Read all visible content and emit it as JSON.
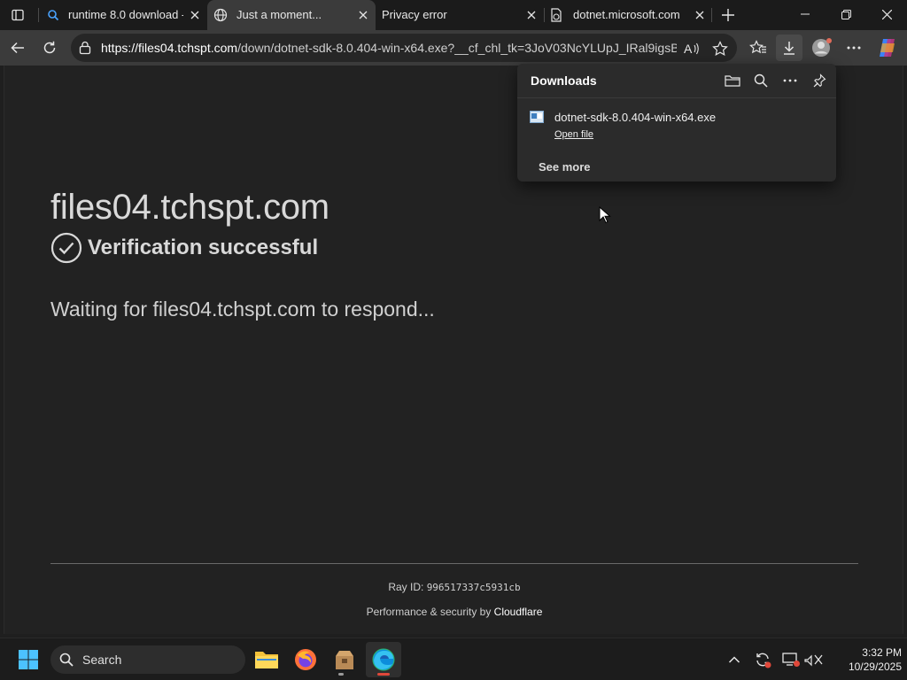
{
  "tabs": [
    {
      "title": "runtime 8.0 download -",
      "icon": "search-icon",
      "active": false
    },
    {
      "title": "Just a moment...",
      "icon": "globe-icon",
      "active": true
    },
    {
      "title": "Privacy error",
      "icon": "none",
      "active": false
    },
    {
      "title": "dotnet.microsoft.com",
      "icon": "warning-page-icon",
      "active": false
    }
  ],
  "address": {
    "host": "https://files04.tchspt.com",
    "rest": "/down/dotnet-sdk-8.0.404-win-x64.exe?__cf_chl_tk=3JoV03NcYLUpJ_IRal9igsB..."
  },
  "page": {
    "host_heading": "files04.tchspt.com",
    "verification": "Verification successful",
    "waiting": "Waiting for files04.tchspt.com to respond...",
    "ray_label": "Ray ID:",
    "ray_id": "996517337c5931cb",
    "perf_label": "Performance & security by",
    "perf_brand": "Cloudflare"
  },
  "downloads": {
    "title": "Downloads",
    "file_name": "dotnet-sdk-8.0.404-win-x64.exe",
    "open_file": "Open file",
    "see_more": "See more"
  },
  "taskbar": {
    "search_label": "Search",
    "time": "3:32 PM",
    "date": "10/29/2025"
  },
  "colors": {
    "accent": "#60cdff",
    "page_bg": "#222222",
    "toolbar_bg": "#3b3b3b"
  }
}
